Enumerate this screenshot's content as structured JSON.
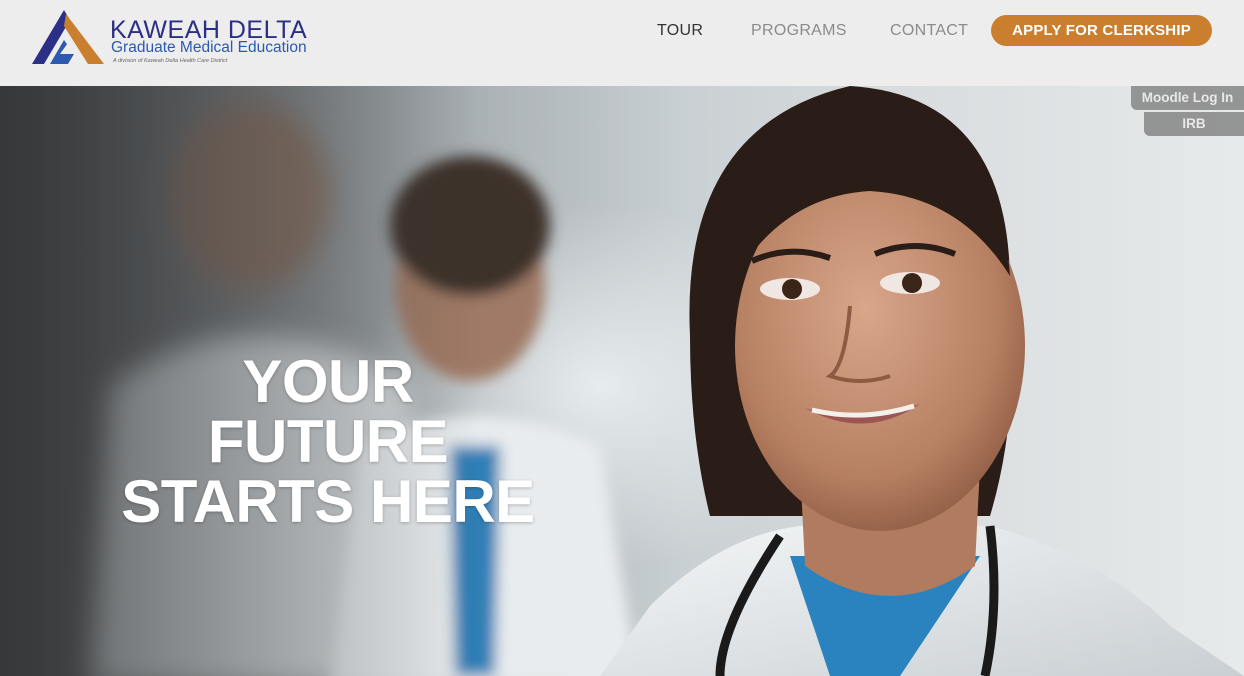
{
  "brand": {
    "title": "KAWEAH DELTA",
    "subtitle": "Graduate Medical Education",
    "tagline": "A division of Kaweah Delta Health Care District",
    "colors": {
      "navy": "#2c2f86",
      "blue": "#2c5ab0",
      "orange": "#c97f2e"
    }
  },
  "nav": {
    "items": [
      {
        "label": "TOUR",
        "active": true
      },
      {
        "label": "PROGRAMS",
        "active": false
      },
      {
        "label": "CONTACT",
        "active": false
      }
    ],
    "cta_label": "APPLY FOR CLERKSHIP"
  },
  "utility": {
    "moodle_label": "Moodle Log In",
    "irb_label": "IRB"
  },
  "hero": {
    "heading_line1": "YOUR FUTURE",
    "heading_line2": "STARTS HERE"
  }
}
